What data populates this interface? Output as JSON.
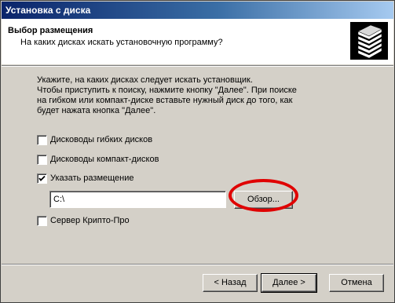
{
  "window": {
    "title": "Установка с диска"
  },
  "header": {
    "title": "Выбор размещения",
    "subtitle": "На каких дисках искать установочную программу?"
  },
  "intro": {
    "line1": "Укажите, на каких дисках следует искать установщик.",
    "line2": "Чтобы приступить к поиску, нажмите кнопку \"Далее\". При поиске",
    "line3": "на гибком или компакт-диске вставьте нужный диск до того, как",
    "line4": "будет нажата кнопка \"Далее\"."
  },
  "options": {
    "floppy": {
      "label": "Дисководы гибких дисков",
      "checked": false
    },
    "cdrom": {
      "label": "Дисководы компакт-дисков",
      "checked": false
    },
    "location": {
      "label": "Указать размещение",
      "checked": true
    },
    "crypto_server": {
      "label": "Сервер Крипто-Про",
      "checked": false
    }
  },
  "location_field": {
    "value": "C:\\"
  },
  "buttons": {
    "browse": "Обзор...",
    "back": "< Назад",
    "next": "Далее >",
    "cancel": "Отмена"
  },
  "colors": {
    "highlight_circle": "#e00000",
    "titlebar": "#0a246a"
  }
}
